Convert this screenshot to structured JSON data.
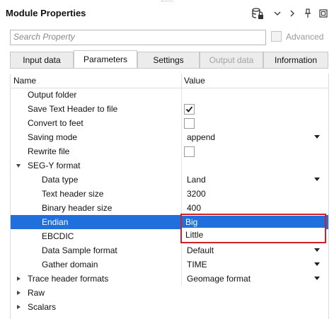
{
  "panel": {
    "title": "Module Properties",
    "toolbar": {
      "db_icon": "database-lock-icon",
      "chevron": "chevron-down-icon",
      "more": ">",
      "pin": "pin-icon",
      "restore": "restore-icon"
    }
  },
  "search": {
    "placeholder": "Search Property",
    "value": ""
  },
  "advanced": {
    "label": "Advanced",
    "checked": false,
    "enabled": false
  },
  "tabs": [
    {
      "label": "Input data",
      "active": false,
      "enabled": true
    },
    {
      "label": "Parameters",
      "active": true,
      "enabled": true
    },
    {
      "label": "Settings",
      "active": false,
      "enabled": true
    },
    {
      "label": "Output data",
      "active": false,
      "enabled": false
    },
    {
      "label": "Information",
      "active": false,
      "enabled": true
    }
  ],
  "grid": {
    "headers": {
      "name": "Name",
      "value": "Value"
    },
    "rows": [
      {
        "name": "Output folder",
        "value": ""
      },
      {
        "name": "Save Text Header to file",
        "value": "",
        "checkbox": true,
        "checked": true
      },
      {
        "name": "Convert to feet",
        "value": "",
        "checkbox": true,
        "checked": false
      },
      {
        "name": "Saving mode",
        "value": "append",
        "dropdown": true
      },
      {
        "name": "Rewrite file",
        "value": "",
        "checkbox": true,
        "checked": false
      },
      {
        "name": "SEG-Y format",
        "value": "",
        "expanded": true
      },
      {
        "name": "Data type",
        "value": "Land",
        "dropdown": true
      },
      {
        "name": "Text header size",
        "value": "3200"
      },
      {
        "name": "Binary header size",
        "value": "400"
      },
      {
        "name": "Endian",
        "value": "",
        "selected": true
      },
      {
        "name": "EBCDIC",
        "value": ""
      },
      {
        "name": "Data Sample format",
        "value": "Default",
        "dropdown": true
      },
      {
        "name": "Gather domain",
        "value": "TIME",
        "dropdown": true
      },
      {
        "name": "Trace header formats",
        "value": "Geomage format",
        "dropdown": true,
        "expanded": false
      },
      {
        "name": "Raw",
        "value": "",
        "expanded": false
      },
      {
        "name": "Scalars",
        "value": "",
        "expanded": false
      }
    ]
  },
  "endian_dropdown": {
    "options": [
      "Big",
      "Little"
    ],
    "highlighted": "Big"
  },
  "colors": {
    "selection": "#1f6fdc",
    "highlight_border": "#d0202a"
  }
}
